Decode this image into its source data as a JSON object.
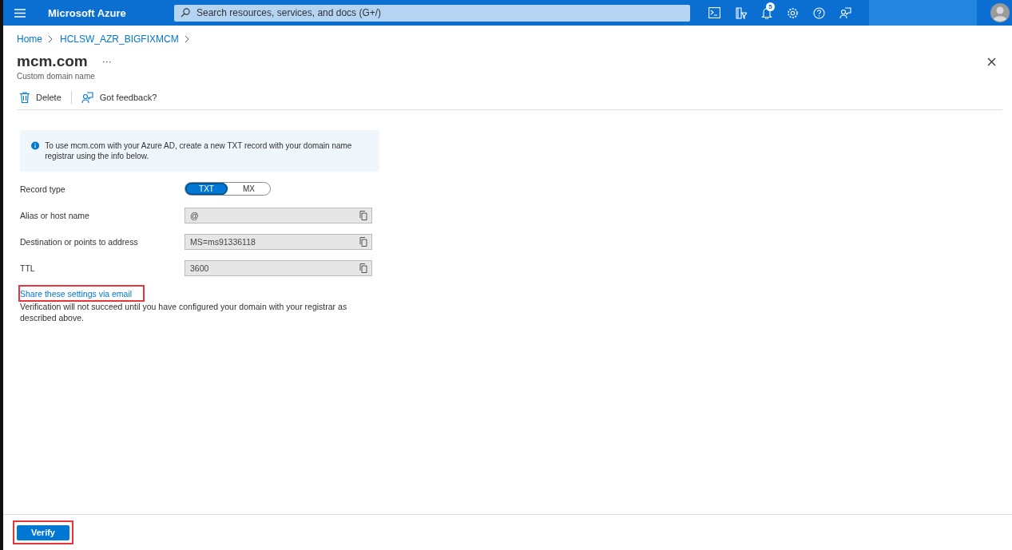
{
  "top_bar": {
    "brand": "Microsoft Azure",
    "search": {
      "placeholder": "Search resources, services, and docs (G+/)"
    },
    "notification_count": "5"
  },
  "breadcrumb": [
    "Home",
    "HCLSW_AZR_BIGFIXMCM"
  ],
  "page": {
    "title": "mcm.com",
    "more": "···",
    "subtitle": "Custom domain name"
  },
  "toolbar": [
    {
      "kind": "delete",
      "label": "Delete"
    },
    {
      "kind": "feedback",
      "label": "Got feedback?"
    }
  ],
  "info": "To use mcm.com with your Azure AD, create a new TXT record with your domain name registrar using the info below.",
  "record_type": {
    "label": "Record type",
    "options": [
      {
        "label": "TXT",
        "selected": true
      },
      {
        "label": "MX",
        "selected": false
      }
    ]
  },
  "fields": [
    {
      "label": "Alias or host name",
      "value": "@"
    },
    {
      "label": "Destination or points to address",
      "value": "MS=ms91336118"
    },
    {
      "label": "TTL",
      "value": "3600"
    }
  ],
  "share_link": {
    "text": "Share these settings via email",
    "highlighted": true
  },
  "note": "Verification will not succeed until you have configured your domain with your registrar as described above.",
  "verify_button": {
    "label": "Verify",
    "highlighted": true
  }
}
